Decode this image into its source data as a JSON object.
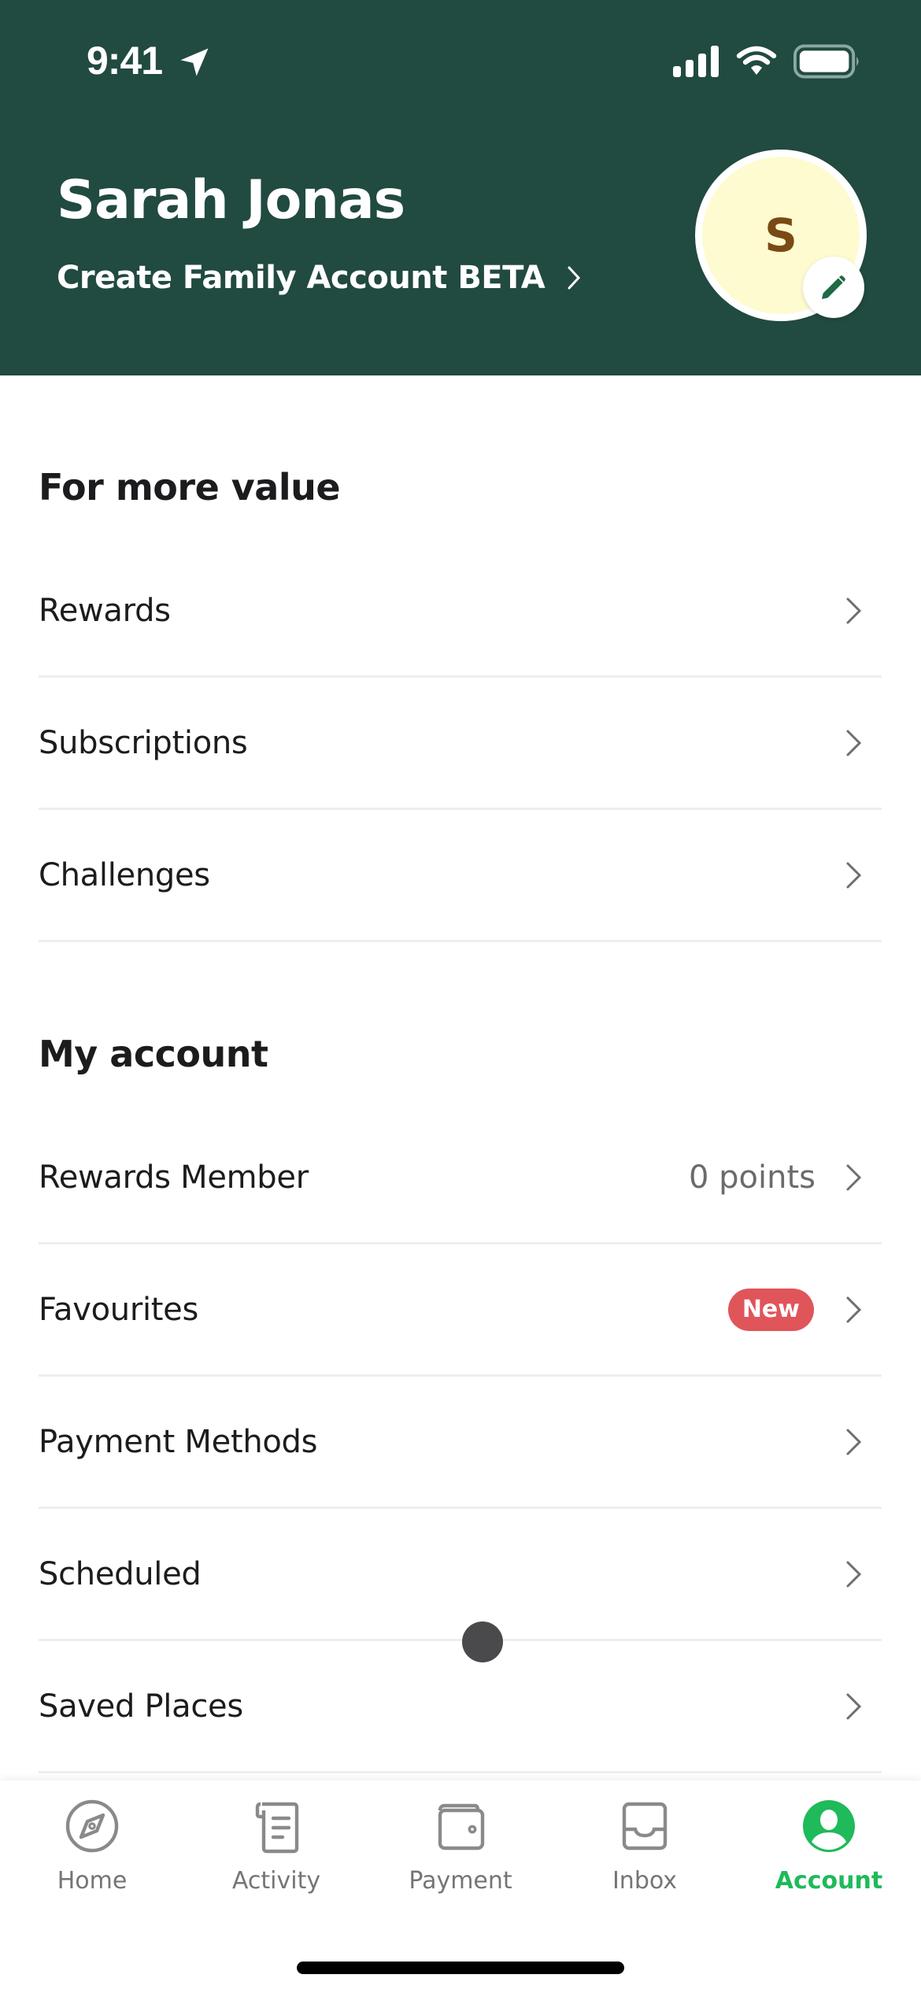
{
  "status_bar": {
    "time": "9:41",
    "icons": [
      "location-arrow-icon",
      "cellular-signal-icon",
      "wifi-icon",
      "battery-icon"
    ]
  },
  "header": {
    "user_name": "Sarah Jonas",
    "family_link": "Create Family Account BETA",
    "avatar_initial": "S",
    "colors": {
      "background": "#214A41",
      "avatar_bg": "#FEFBD0",
      "avatar_text": "#7A4A14",
      "edit_icon": "#1E6B45"
    }
  },
  "sections": [
    {
      "title": "For more value",
      "items": [
        {
          "label": "Rewards"
        },
        {
          "label": "Subscriptions"
        },
        {
          "label": "Challenges"
        }
      ]
    },
    {
      "title": "My account",
      "items": [
        {
          "label": "Rewards Member",
          "value": "0 points"
        },
        {
          "label": "Favourites",
          "badge": "New"
        },
        {
          "label": "Payment Methods"
        },
        {
          "label": "Scheduled"
        },
        {
          "label": "Saved Places"
        }
      ]
    }
  ],
  "tabbar": {
    "active": "Account",
    "accent": "#1FBA5A",
    "tabs": [
      {
        "label": "Home",
        "icon": "compass-icon"
      },
      {
        "label": "Activity",
        "icon": "receipt-icon"
      },
      {
        "label": "Payment",
        "icon": "wallet-icon"
      },
      {
        "label": "Inbox",
        "icon": "inbox-icon"
      },
      {
        "label": "Account",
        "icon": "account-icon"
      }
    ]
  }
}
